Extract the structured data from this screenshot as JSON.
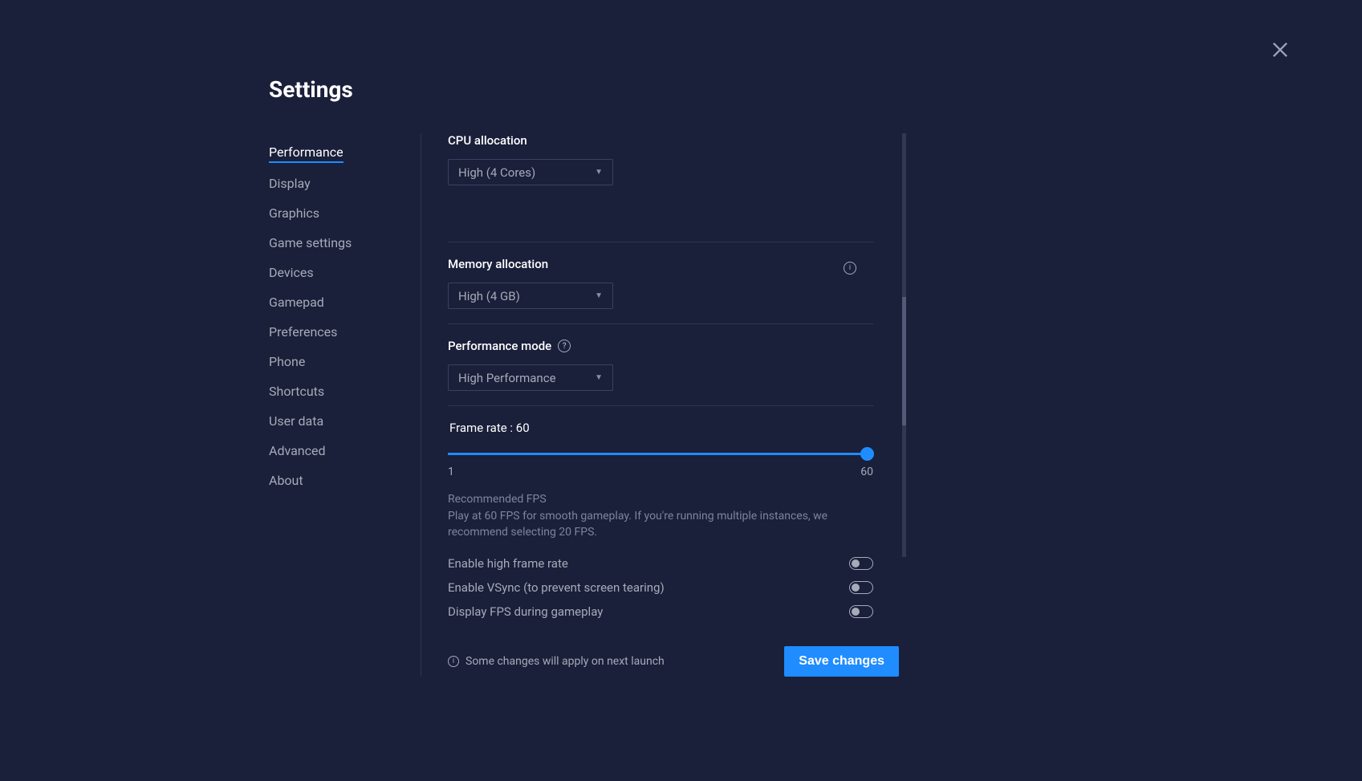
{
  "title": "Settings",
  "sidebar": {
    "items": [
      "Performance",
      "Display",
      "Graphics",
      "Game settings",
      "Devices",
      "Gamepad",
      "Preferences",
      "Phone",
      "Shortcuts",
      "User data",
      "Advanced",
      "About"
    ],
    "activeIndex": 0
  },
  "cpu": {
    "label": "CPU allocation",
    "value": "High (4 Cores)"
  },
  "memory": {
    "label": "Memory allocation",
    "value": "High (4 GB)"
  },
  "perfMode": {
    "label": "Performance mode",
    "value": "High Performance"
  },
  "frameRate": {
    "labelPrefix": "Frame rate : ",
    "value": "60",
    "min": "1",
    "max": "60"
  },
  "recommended": {
    "title": "Recommended FPS",
    "text": "Play at 60 FPS for smooth gameplay. If you're running multiple instances, we recommend selecting 20 FPS."
  },
  "toggles": {
    "highFrame": "Enable high frame rate",
    "vsync": "Enable VSync (to prevent screen tearing)",
    "displayFps": "Display FPS during gameplay"
  },
  "footer": {
    "note": "Some changes will apply on next launch",
    "saveLabel": "Save changes"
  }
}
